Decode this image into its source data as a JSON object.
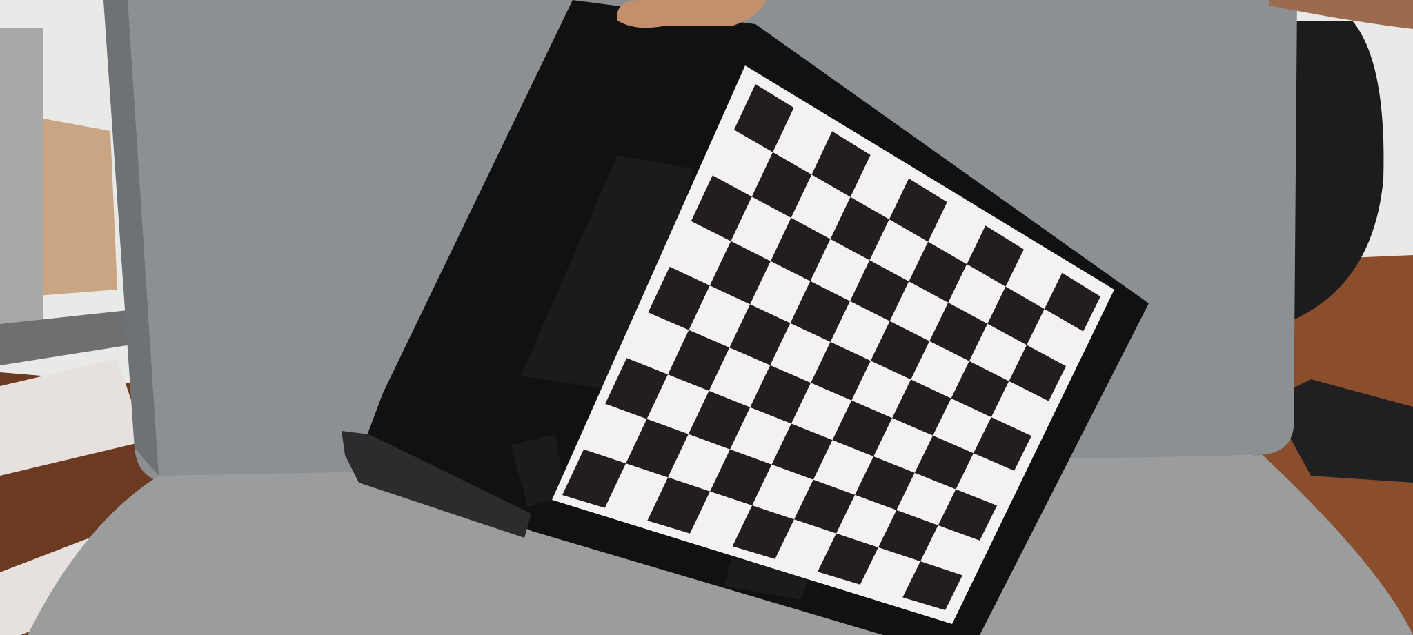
{
  "image": {
    "subject": "",
    "colors": {
      "wall": "#e9e9e7",
      "floor": "#6b3a20",
      "floor_light": "#8a4e2c",
      "cushion": "#8d9092",
      "cushion_dark": "#6f7275",
      "seat": "#9a9c9e",
      "board_frame": "#111112",
      "board_frame_edge": "#2c2c2e",
      "tape": "#1b1b1d",
      "square_dark": "#221d1e",
      "square_light": "#f3f2f1",
      "skin": "#c48f6c",
      "stand_metal": "#a8a8a6",
      "newspaper": "#e6e1de",
      "cardboard": "#c9a583"
    },
    "checkerboard": {
      "rows": 9,
      "cols": 9
    }
  }
}
